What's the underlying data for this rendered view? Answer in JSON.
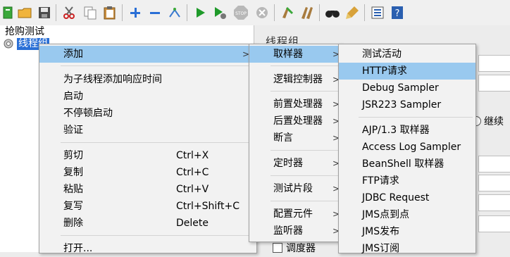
{
  "toolbar": {
    "icons": [
      "new-plan-icon",
      "open-folder-icon",
      "save-icon",
      "cut-icon",
      "copy-icon",
      "paste-icon",
      "expand-icon",
      "collapse-icon",
      "toggle-icon",
      "start-icon",
      "start-no-pause-icon",
      "stop-icon",
      "shutdown-icon",
      "clear-icon",
      "clear-all-icon",
      "search-icon",
      "reset-search-icon",
      "function-helper-icon",
      "help-icon"
    ]
  },
  "tree": {
    "root_label": "抢购测试",
    "node_label": "线程组"
  },
  "right_panel": {
    "title": "线程组",
    "continue_label": "继续",
    "scheduler_label": "调度器"
  },
  "context_menu": {
    "items": [
      {
        "label": "添加",
        "shortcut": "",
        "submenu": true
      },
      {
        "label": "为子线程添加响应时间",
        "shortcut": ""
      },
      {
        "label": "启动",
        "shortcut": ""
      },
      {
        "label": "不停顿启动",
        "shortcut": ""
      },
      {
        "label": "验证",
        "shortcut": ""
      },
      {
        "label": "剪切",
        "shortcut": "Ctrl+X"
      },
      {
        "label": "复制",
        "shortcut": "Ctrl+C"
      },
      {
        "label": "粘贴",
        "shortcut": "Ctrl+V"
      },
      {
        "label": "复写",
        "shortcut": "Ctrl+Shift+C"
      },
      {
        "label": "删除",
        "shortcut": "Delete"
      },
      {
        "label": "打开...",
        "shortcut": ""
      }
    ]
  },
  "add_submenu": {
    "items": [
      {
        "label": "取样器"
      },
      {
        "label": "逻辑控制器"
      },
      {
        "label": "前置处理器"
      },
      {
        "label": "后置处理器"
      },
      {
        "label": "断言"
      },
      {
        "label": "定时器"
      },
      {
        "label": "测试片段"
      },
      {
        "label": "配置元件"
      },
      {
        "label": "监听器"
      }
    ]
  },
  "sampler_submenu": {
    "items": [
      {
        "label": "测试活动"
      },
      {
        "label": "HTTP请求"
      },
      {
        "label": "Debug Sampler"
      },
      {
        "label": "JSR223 Sampler"
      },
      {
        "label": "AJP/1.3 取样器"
      },
      {
        "label": "Access Log Sampler"
      },
      {
        "label": "BeanShell 取样器"
      },
      {
        "label": "FTP请求"
      },
      {
        "label": "JDBC Request"
      },
      {
        "label": "JMS点到点"
      },
      {
        "label": "JMS发布"
      },
      {
        "label": "JMS订阅"
      }
    ]
  },
  "colors": {
    "highlight": "#99c9ef",
    "selection": "#2a6fd6"
  }
}
